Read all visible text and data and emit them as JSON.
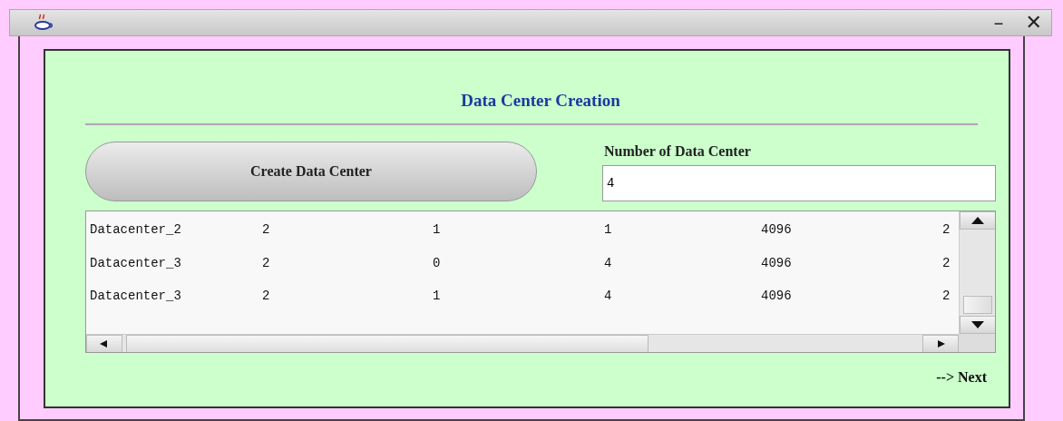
{
  "window": {
    "minimize": "–",
    "close": "✕"
  },
  "panel": {
    "title": "Data Center Creation",
    "create_button": "Create Data Center",
    "count_label": "Number of Data Center",
    "count_value": "4",
    "rows": [
      [
        "Datacenter_2",
        "2",
        "1",
        "1",
        "4096",
        "2"
      ],
      [
        "Datacenter_3",
        "2",
        "0",
        "4",
        "4096",
        "2"
      ],
      [
        "Datacenter_3",
        "2",
        "1",
        "4",
        "4096",
        "2"
      ]
    ],
    "next_link": "--> Next"
  }
}
